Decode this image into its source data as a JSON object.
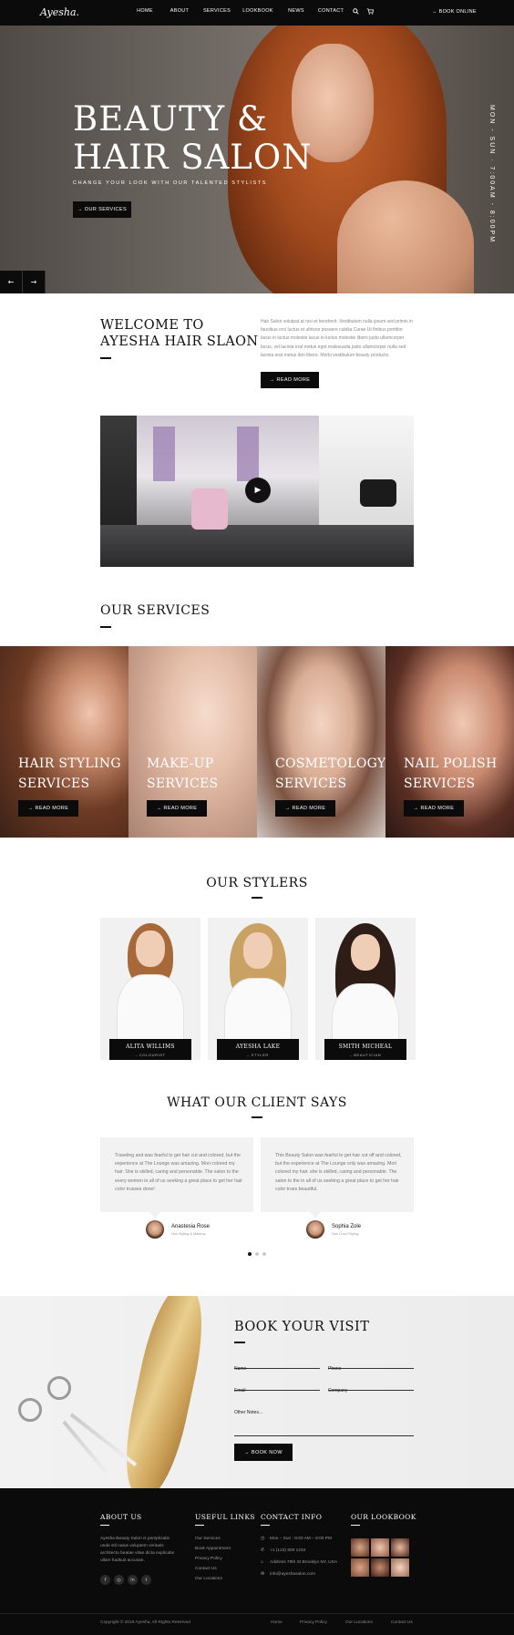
{
  "header": {
    "logo": "Ayesha.",
    "nav": [
      "HOME",
      "ABOUT",
      "SERVICES",
      "LOOKBOOK",
      "NEWS",
      "CONTACT"
    ],
    "search_icon": "search-icon",
    "cart_icon": "cart-icon",
    "book_online": "→  BOOK ONLINE"
  },
  "hero": {
    "title_line1": "BEAUTY &",
    "title_line2": "HAIR SALON",
    "subtitle": "CHANGE YOUR LOOK WITH OUR TALENTED STYLISTS",
    "button": "→  OUR SERVICES",
    "hours_vertical": "MON - SUN · 7:00AM - 8:00PM",
    "prev": "←",
    "next": "→"
  },
  "welcome": {
    "title_line1": "WELCOME TO",
    "title_line2": "AYESHA HAIR SLAON",
    "text": "Hair Salon volutpat at nisi et hendrerit. Vestibulum nulla ipsum sed primis in faucibus orci luctus et ultrices posuere cubilia Curae Ut finibus porttitor lacus in luctus molestie lacus in luctus molestie libero justo ullamcorper lacus, vel lacinia erat metus eget malesuada justo ullamcorper nulla sed lacinia erat metus don libero. Morbi vestibulum beauty products.",
    "button": "→  READ MORE",
    "play_icon": "▶"
  },
  "services": {
    "title": "OUR SERVICES",
    "items": [
      {
        "line1": "HAIR STYLING",
        "line2": "SERVICES",
        "button": "→  READ MORE"
      },
      {
        "line1": "MAKE-UP",
        "line2": "SERVICES",
        "button": "→  READ MORE"
      },
      {
        "line1": "COSMETOLOGY",
        "line2": "SERVICES",
        "button": "→  READ MORE"
      },
      {
        "line1": "NAIL POLISH",
        "line2": "SERVICES",
        "button": "→  READ MORE"
      }
    ]
  },
  "stylers": {
    "title": "OUR STYLERS",
    "items": [
      {
        "name": "ALITA WILLIMS",
        "role": "– COLOURIST"
      },
      {
        "name": "AYESHA LAKE",
        "role": "– STYLER"
      },
      {
        "name": "SMITH MICHEAL",
        "role": "– BEAUTICIAN"
      }
    ]
  },
  "testimonials": {
    "title": "WHAT OUR CLIENT SAYS",
    "items": [
      {
        "text": "Traveling and was fearful to get hair cut and colored, but the experience at The Lounge was amazing. Mori colored my hair. She is skilled, caring and personable. The salon to the every women in all of us seeking a great place to get her hair color trusses done!",
        "name": "Anastesia Rose",
        "role": "Hair Styling & Makeup"
      },
      {
        "text": "This Beauty Salon was fearful to get hair cut off and colored, but the experience at The Lounge only was amazing. Mori colored my hair. she is skilled, caring and personable. The salon to the in all of us seeking a great place to get her hair color trues beautiful.",
        "name": "Sophia Zole",
        "role": "Hair Color Styling"
      }
    ]
  },
  "booking": {
    "title": "BOOK YOUR VISIT",
    "fields": {
      "name": "Name",
      "phone": "Phone",
      "email": "Email",
      "company": "Company",
      "notes": "Other Notes..."
    },
    "button": "→  BOOK NOW"
  },
  "footer": {
    "about": {
      "title": "ABOUT US",
      "text": "Ayesha Beauty Salon is persplciatis unde stil natus voluptem veritatis architecto beatae vitae dicta explicabo ullam hadsuit accusan."
    },
    "useful": {
      "title": "USEFUL LINKS",
      "links": [
        "Our Services",
        "Book Appointment",
        "Privacy Policy",
        "Contact Us",
        "Our Locations"
      ]
    },
    "contact": {
      "title": "CONTACT INFO",
      "hours": "Mon – Sun :  8:00 AM – 8:00 PM",
      "phone": "+1 (123) 800 1234",
      "address": "Address 79th St Brooklyn NY, USA",
      "email": "info@ayeshasalon.com"
    },
    "lookbook": {
      "title": "OUR LOOKBOOK"
    },
    "copyright": "Copyright © 2019 Ayesha, All Rights Reserved",
    "bottom_links": [
      "Home",
      "Privacy Policy",
      "Our Locations",
      "Contact Us"
    ]
  },
  "colors": {
    "dark": "#0b0b0b",
    "muted_text": "#888888",
    "card_bg": "#f2f2f2"
  }
}
